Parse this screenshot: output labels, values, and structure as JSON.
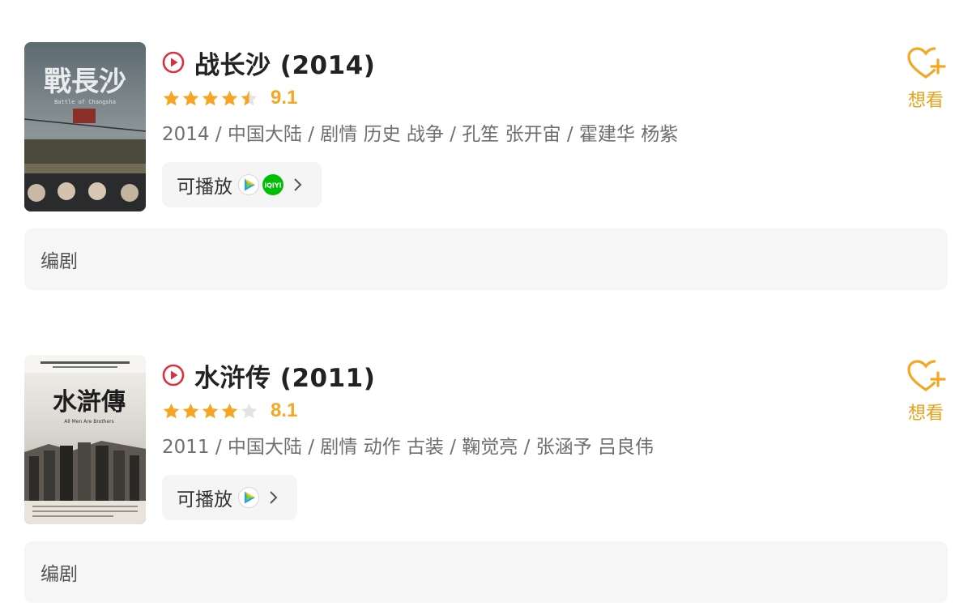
{
  "colors": {
    "accent_orange": "#f5a623",
    "play_red": "#d9313e",
    "want_label": "#e6a21a",
    "meta_gray": "#6f6f6f",
    "panel_bg": "#f5f5f5"
  },
  "movies": [
    {
      "poster_icon": "poster-image",
      "poster_text": "戰長沙",
      "poster_subtitle": "Battle of Changsha",
      "title": "战长沙 (2014)",
      "stars": 4.5,
      "score": "9.1",
      "meta": "2014 / 中国大陆 / 剧情 历史 战争 / 孔笙 张开宙 / 霍建华 杨紫",
      "playable_label": "可播放",
      "platforms": [
        "tencent-video-icon",
        "iqiyi-icon"
      ],
      "want_label": "想看",
      "writer_label": "编剧"
    },
    {
      "poster_icon": "poster-image",
      "poster_text": "水滸傳",
      "poster_subtitle": "All Men Are Brothers",
      "title": "水浒传 (2011)",
      "stars": 4,
      "score": "8.1",
      "meta": "2011 / 中国大陆 / 剧情 动作 古装 / 鞠觉亮 / 张涵予 吕良伟",
      "playable_label": "可播放",
      "platforms": [
        "tencent-video-icon"
      ],
      "want_label": "想看",
      "writer_label": "编剧"
    }
  ]
}
